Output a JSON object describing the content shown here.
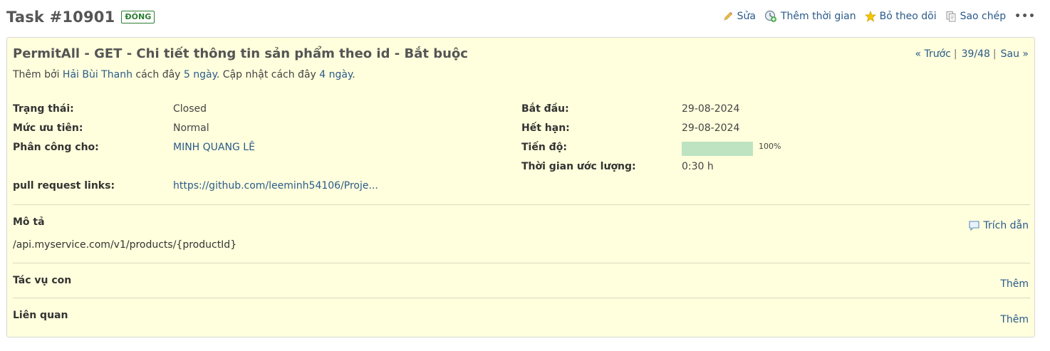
{
  "header": {
    "task_title": "Task #10901",
    "status_badge": "ĐÓNG",
    "actions": {
      "edit": "Sửa",
      "log_time": "Thêm thời gian",
      "unwatch": "Bỏ theo dõi",
      "copy": "Sao chép",
      "more": "•••"
    }
  },
  "issue": {
    "subject": "PermitAll - GET - Chi tiết thông tin sản phẩm theo id - Bắt buộc",
    "nav": {
      "prev": "« Trước",
      "position": "39/48",
      "next": "Sau »",
      "sep": "|"
    },
    "author": {
      "added_by_prefix": "Thêm bởi",
      "author_name": "Hải Bùi Thanh",
      "ago_prefix": "cách đây",
      "created_ago": "5 ngày",
      "updated_prefix": ". Cập nhật cách đây",
      "updated_ago": "4 ngày",
      "end": "."
    },
    "attributes": {
      "status_label": "Trạng thái:",
      "status_value": "Closed",
      "priority_label": "Mức ưu tiên:",
      "priority_value": "Normal",
      "assignee_label": "Phân công cho:",
      "assignee_value": "MINH QUANG LÊ",
      "pr_label": "pull request links:",
      "pr_value": "https://github.com/leeminh54106/Proje...",
      "start_label": "Bắt đầu:",
      "start_value": "29-08-2024",
      "due_label": "Hết hạn:",
      "due_value": "29-08-2024",
      "progress_label": "Tiến độ:",
      "progress_pct": "100%",
      "progress_fraction": 1.0,
      "estimate_label": "Thời gian ước lượng:",
      "estimate_value": "0:30 h"
    },
    "description": {
      "title": "Mô tả",
      "quote": "Trích dẫn",
      "text": "/api.myservice.com/v1/products/{productId}"
    },
    "subtasks": {
      "title": "Tác vụ con",
      "add": "Thêm"
    },
    "relations": {
      "title": "Liên quan",
      "add": "Thêm"
    }
  },
  "colors": {
    "panel_bg": "#ffffdd",
    "link": "#2a5a8a",
    "status_green": "#2e7d32",
    "progress_fill": "#bde3c1"
  }
}
